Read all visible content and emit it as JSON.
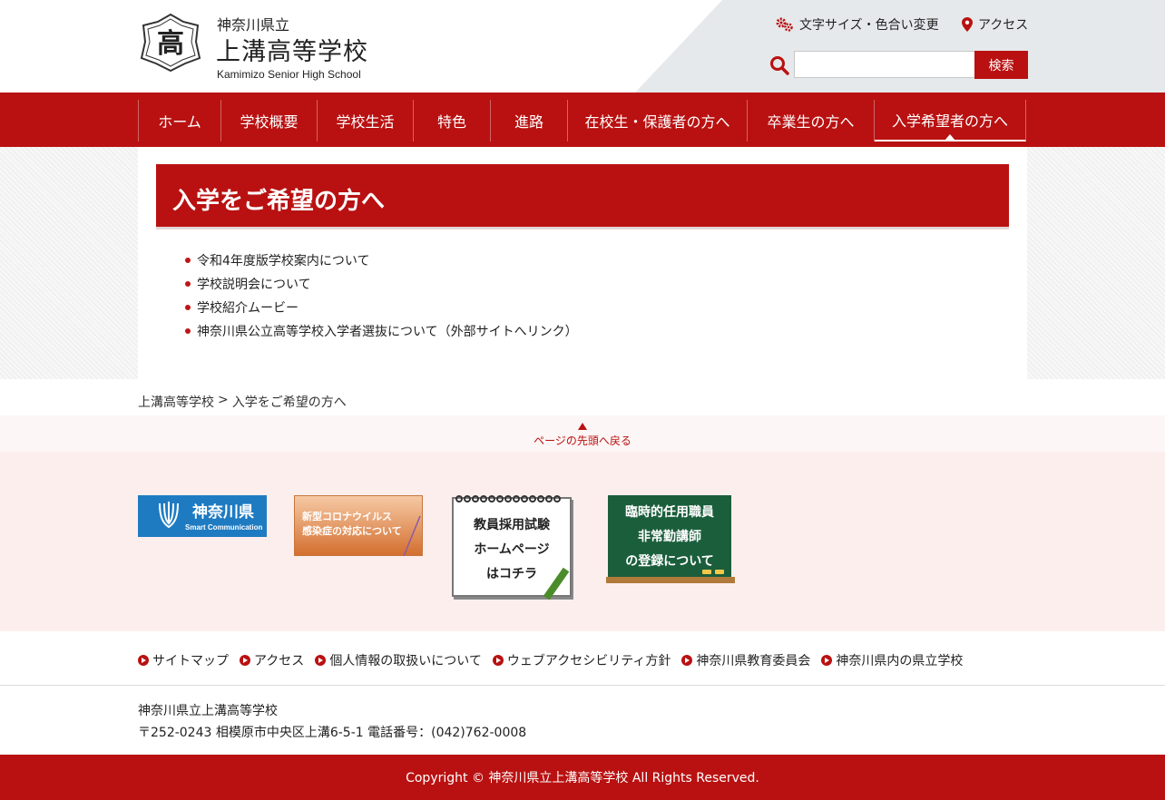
{
  "header": {
    "logo_glyph": "高",
    "prefecture": "神奈川県立",
    "school_name": "上溝高等学校",
    "school_name_en": "Kamimizo Senior High School",
    "util_fontsize_label": "文字サイズ・色合い変更",
    "util_access_label": "アクセス",
    "search_placeholder": "",
    "search_button_label": "検索"
  },
  "gnav": {
    "items": [
      {
        "label": "ホーム"
      },
      {
        "label": "学校概要"
      },
      {
        "label": "学校生活"
      },
      {
        "label": "特色"
      },
      {
        "label": "進路"
      },
      {
        "label": "在校生・保護者の方へ"
      },
      {
        "label": "卒業生の方へ"
      },
      {
        "label": "入学希望者の方へ",
        "active": true
      }
    ]
  },
  "main": {
    "page_title": "入学をご希望の方へ",
    "links": [
      "令和4年度版学校案内について",
      "学校説明会について",
      "学校紹介ムービー",
      "神奈川県公立高等学校入学者選抜について（外部サイトへリンク）"
    ]
  },
  "breadcrumb": {
    "home": "上溝高等学校",
    "separator": ">",
    "current": "入学をご希望の方へ"
  },
  "pagetop_label": "ページの先頭へ戻る",
  "banners": {
    "kanagawa": {
      "title": "神奈川県",
      "sub": "Smart Communication"
    },
    "corona": {
      "line1": "新型コロナウイルス",
      "line2": "感染症の対応について"
    },
    "teacher": {
      "line1": "教員採用試験",
      "line2": "ホームページ",
      "line3": "はコチラ"
    },
    "temp": {
      "line1": "臨時的任用職員",
      "line2": "非常勤講師",
      "line3": "の登録について"
    }
  },
  "footer": {
    "links": [
      "サイトマップ",
      "アクセス",
      "個人情報の取扱いについて",
      "ウェブアクセシビリティ方針",
      "神奈川県教育委員会",
      "神奈川県内の県立学校"
    ],
    "school": "神奈川県立上溝高等学校",
    "address": "〒252-0243 相模原市中央区上溝6-5-1 電話番号：(042)762-0008",
    "copyright": "Copyright © 神奈川県立上溝高等学校 All Rights Reserved."
  },
  "colors": {
    "brand_red": "#b91111",
    "header_gray": "#e6e9eb",
    "banner_bg": "#fdeeee"
  }
}
